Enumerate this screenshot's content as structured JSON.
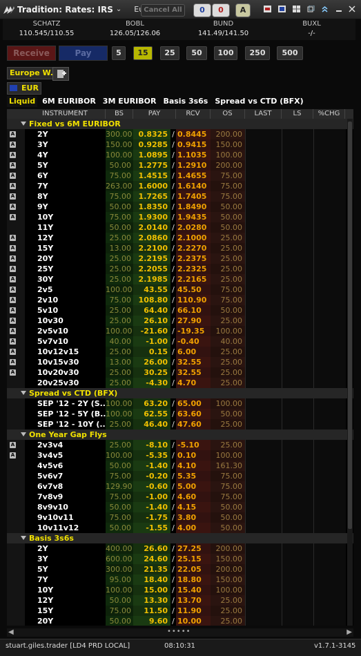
{
  "titlebar": {
    "title": "Tradition: Rates: IRS",
    "region": "Eur...",
    "cancel_all": "Cancel All",
    "counter_blue": "0",
    "counter_red": "0",
    "badge_a": "A"
  },
  "benchmarks": {
    "headers": [
      "SCHATZ",
      "BOBL",
      "BUND",
      "BUXL"
    ],
    "values": [
      "110.545/110.55",
      "126.05/126.06",
      "141.49/141.50",
      "-/-"
    ]
  },
  "actions": {
    "receive": "Receive",
    "pay": "Pay",
    "sizes": [
      "5",
      "15",
      "25",
      "50",
      "100",
      "250",
      "500"
    ],
    "selected_size": "15"
  },
  "tabs": {
    "workspace": "Europe W.",
    "currency": "EUR",
    "sub": [
      "Liquid",
      "6M EURIBOR",
      "3M EURIBOR",
      "Basis 3s6s",
      "Spread vs CTD (BFX)"
    ],
    "active_sub": "Liquid"
  },
  "columns": [
    "INSTRUMENT",
    "BS",
    "PAY",
    "RCV",
    "OS",
    "LAST",
    "LS",
    "%CHG"
  ],
  "groups": [
    {
      "name": "Fixed vs 6M EURIBOR",
      "rows": [
        {
          "a": true,
          "i": "2Y",
          "bs": "300.00",
          "pay": "0.8325",
          "rcv": "0.8445",
          "os": "200.00"
        },
        {
          "a": true,
          "i": "3Y",
          "bs": "150.00",
          "pay": "0.9285",
          "rcv": "0.9415",
          "os": "150.00"
        },
        {
          "a": true,
          "i": "4Y",
          "bs": "100.00",
          "pay": "1.0895",
          "rcv": "1.1035",
          "os": "100.00"
        },
        {
          "a": true,
          "i": "5Y",
          "bs": "50.00",
          "pay": "1.2775",
          "rcv": "1.2910",
          "os": "200.00"
        },
        {
          "a": true,
          "i": "6Y",
          "bs": "75.00",
          "pay": "1.4515",
          "rcv": "1.4655",
          "os": "75.00"
        },
        {
          "a": true,
          "i": "7Y",
          "bs": "263.00",
          "pay": "1.6000",
          "rcv": "1.6140",
          "os": "75.00"
        },
        {
          "a": true,
          "i": "8Y",
          "bs": "75.00",
          "pay": "1.7265",
          "rcv": "1.7405",
          "os": "75.00"
        },
        {
          "a": true,
          "i": "9Y",
          "bs": "50.00",
          "pay": "1.8350",
          "rcv": "1.8490",
          "os": "50.00"
        },
        {
          "a": true,
          "i": "10Y",
          "bs": "75.00",
          "pay": "1.9300",
          "rcv": "1.9435",
          "os": "50.00"
        },
        {
          "a": false,
          "i": "11Y",
          "bs": "50.00",
          "pay": "2.0140",
          "rcv": "2.0280",
          "os": "50.00"
        },
        {
          "a": true,
          "i": "12Y",
          "bs": "25.00",
          "pay": "2.0860",
          "rcv": "2.1000",
          "os": "25.00"
        },
        {
          "a": true,
          "i": "15Y",
          "bs": "13.00",
          "pay": "2.2100",
          "rcv": "2.2270",
          "os": "25.00"
        },
        {
          "a": true,
          "i": "20Y",
          "bs": "25.00",
          "pay": "2.2195",
          "rcv": "2.2375",
          "os": "25.00"
        },
        {
          "a": true,
          "i": "25Y",
          "bs": "25.00",
          "pay": "2.2055",
          "rcv": "2.2325",
          "os": "25.00"
        },
        {
          "a": true,
          "i": "30Y",
          "bs": "25.00",
          "pay": "2.1985",
          "rcv": "2.2165",
          "os": "25.00"
        },
        {
          "a": true,
          "i": "2v5",
          "bs": "100.00",
          "pay": "43.55",
          "rcv": "45.50",
          "os": "75.00"
        },
        {
          "a": true,
          "i": "2v10",
          "bs": "75.00",
          "pay": "108.80",
          "rcv": "110.90",
          "os": "75.00"
        },
        {
          "a": true,
          "i": "5v10",
          "bs": "25.00",
          "pay": "64.40",
          "rcv": "66.10",
          "os": "50.00"
        },
        {
          "a": true,
          "i": "10v30",
          "bs": "25.00",
          "pay": "26.10",
          "rcv": "27.90",
          "os": "25.00"
        },
        {
          "a": true,
          "i": "2v5v10",
          "bs": "100.00",
          "pay": "-21.60",
          "rcv": "-19.35",
          "os": "100.00"
        },
        {
          "a": true,
          "i": "5v7v10",
          "bs": "40.00",
          "pay": "-1.00",
          "rcv": "-0.40",
          "os": "40.00"
        },
        {
          "a": true,
          "i": "10v12v15",
          "bs": "25.00",
          "pay": "0.15",
          "rcv": "6.00",
          "os": "25.00"
        },
        {
          "a": true,
          "i": "10v15v30",
          "bs": "13.00",
          "pay": "26.00",
          "rcv": "32.55",
          "os": "25.00"
        },
        {
          "a": true,
          "i": "10v20v30",
          "bs": "25.00",
          "pay": "30.25",
          "rcv": "32.55",
          "os": "25.00"
        },
        {
          "a": false,
          "i": "20v25v30",
          "bs": "25.00",
          "pay": "-4.30",
          "rcv": "4.70",
          "os": "25.00"
        }
      ]
    },
    {
      "name": "Spread vs CTD (BFX)",
      "rows": [
        {
          "a": false,
          "i": "SEP '12 - 2Y (S...",
          "bs": "100.00",
          "pay": "63.20",
          "rcv": "65.00",
          "os": "100.00"
        },
        {
          "a": false,
          "i": "SEP '12 - 5Y (B...",
          "bs": "100.00",
          "pay": "62.55",
          "rcv": "63.60",
          "os": "50.00"
        },
        {
          "a": false,
          "i": "SEP '12 - 10Y (...",
          "bs": "25.00",
          "pay": "46.40",
          "rcv": "47.60",
          "os": "25.00"
        }
      ]
    },
    {
      "name": "One Year Gap Flys",
      "rows": [
        {
          "a": true,
          "i": "2v3v4",
          "bs": "25.00",
          "pay": "-8.10",
          "rcv": "-5.10",
          "os": "25.00"
        },
        {
          "a": true,
          "i": "3v4v5",
          "bs": "100.00",
          "pay": "-5.35",
          "rcv": "0.10",
          "os": "100.00"
        },
        {
          "a": false,
          "i": "4v5v6",
          "bs": "50.00",
          "pay": "-1.40",
          "rcv": "4.10",
          "os": "161.30"
        },
        {
          "a": false,
          "i": "5v6v7",
          "bs": "75.00",
          "pay": "-0.20",
          "rcv": "5.35",
          "os": "75.00"
        },
        {
          "a": false,
          "i": "6v7v8",
          "bs": "129.90",
          "pay": "-0.60",
          "rcv": "5.00",
          "os": "75.00"
        },
        {
          "a": false,
          "i": "7v8v9",
          "bs": "75.00",
          "pay": "-1.00",
          "rcv": "4.60",
          "os": "75.00"
        },
        {
          "a": false,
          "i": "8v9v10",
          "bs": "50.00",
          "pay": "-1.40",
          "rcv": "4.15",
          "os": "50.00"
        },
        {
          "a": false,
          "i": "9v10v11",
          "bs": "75.00",
          "pay": "-1.75",
          "rcv": "3.80",
          "os": "50.00"
        },
        {
          "a": false,
          "i": "10v11v12",
          "bs": "50.00",
          "pay": "-1.55",
          "rcv": "4.00",
          "os": "50.00"
        }
      ]
    },
    {
      "name": "Basis 3s6s",
      "rows": [
        {
          "a": false,
          "i": "2Y",
          "bs": "400.00",
          "pay": "26.60",
          "rcv": "27.25",
          "os": "200.00"
        },
        {
          "a": false,
          "i": "3Y",
          "bs": "600.00",
          "pay": "24.60",
          "rcv": "25.15",
          "os": "150.00"
        },
        {
          "a": false,
          "i": "5Y",
          "bs": "300.00",
          "pay": "21.35",
          "rcv": "22.05",
          "os": "200.00"
        },
        {
          "a": false,
          "i": "7Y",
          "bs": "95.00",
          "pay": "18.40",
          "rcv": "18.80",
          "os": "150.00"
        },
        {
          "a": false,
          "i": "10Y",
          "bs": "100.00",
          "pay": "15.00",
          "rcv": "15.40",
          "os": "100.00"
        },
        {
          "a": false,
          "i": "12Y",
          "bs": "50.00",
          "pay": "13.30",
          "rcv": "13.70",
          "os": "25.00"
        },
        {
          "a": false,
          "i": "15Y",
          "bs": "75.00",
          "pay": "11.50",
          "rcv": "11.90",
          "os": "25.00"
        },
        {
          "a": false,
          "i": "20Y",
          "bs": "50.00",
          "pay": "9.60",
          "rcv": "10.00",
          "os": "25.00"
        }
      ]
    }
  ],
  "status": {
    "user": "stuart.giles.trader [LD4 PRD LOCAL]",
    "time": "08:10:31",
    "version": "v1.7.1-3145"
  }
}
